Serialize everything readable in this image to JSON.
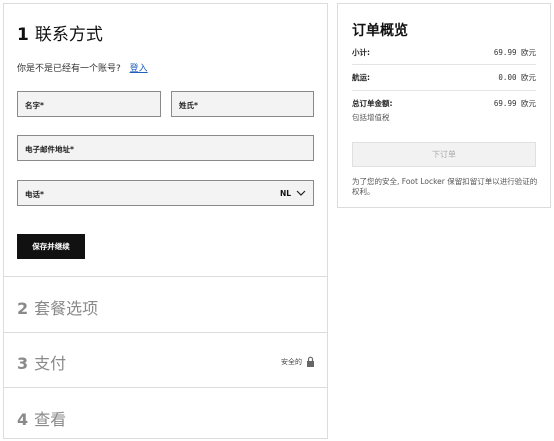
{
  "checkout": {
    "step1": {
      "number": "1",
      "title": "联系方式"
    },
    "account_prompt": "你是不是已经有一个账号?",
    "login_link": "登入",
    "fields": {
      "first_name": "名字*",
      "last_name": "姓氏*",
      "email": "电子邮件地址*",
      "phone": "电话*",
      "country_code": "NL"
    },
    "save_button": "保存并继续",
    "step2": {
      "number": "2",
      "title": "套餐选项"
    },
    "step3": {
      "number": "3",
      "title": "支付"
    },
    "secure_label": "安全的",
    "step4": {
      "number": "4",
      "title": "查看"
    }
  },
  "summary": {
    "title": "订单概览",
    "subtotal_label": "小计:",
    "subtotal_value": "69.99 欧元",
    "shipping_label": "航运:",
    "shipping_value": "0.00 欧元",
    "total_label": "总订单金额:",
    "total_value": "69.99 欧元",
    "tax_note": "包括增值税",
    "order_button": "下订单",
    "notice": "为了您的安全, Foot Locker 保留扣留订单以进行验证的权利。"
  }
}
